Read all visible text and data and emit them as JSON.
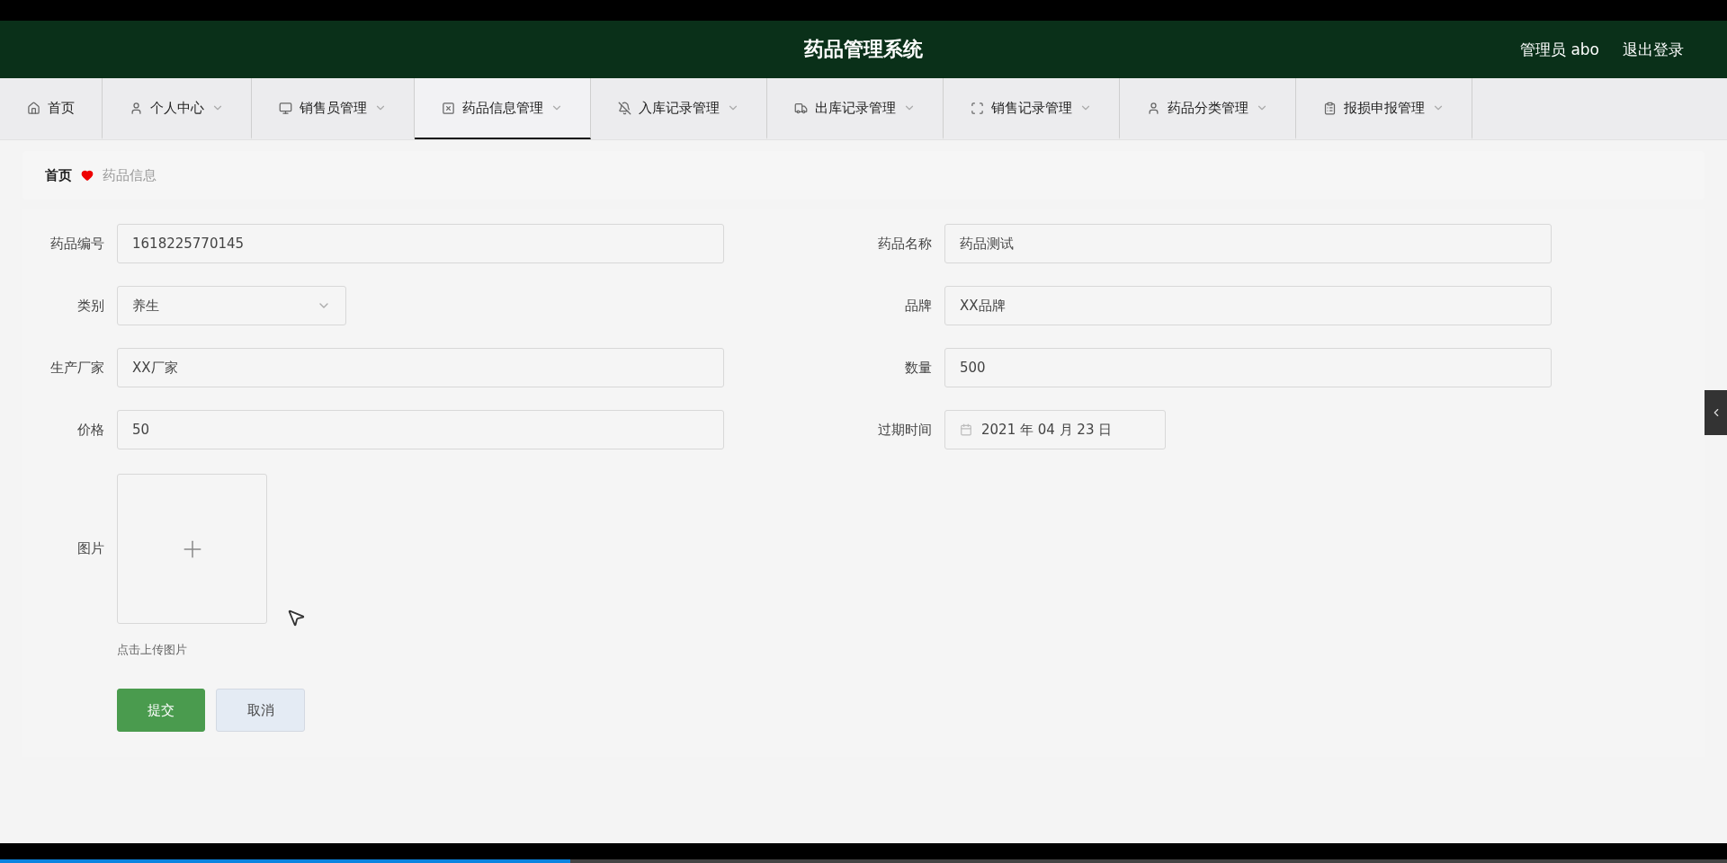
{
  "header": {
    "title": "药品管理系统",
    "user": "管理员 abo",
    "logout": "退出登录"
  },
  "nav": [
    {
      "label": "首页",
      "dropdown": false,
      "selected": false
    },
    {
      "label": "个人中心",
      "dropdown": true,
      "selected": false
    },
    {
      "label": "销售员管理",
      "dropdown": true,
      "selected": false
    },
    {
      "label": "药品信息管理",
      "dropdown": true,
      "selected": true
    },
    {
      "label": "入库记录管理",
      "dropdown": true,
      "selected": false
    },
    {
      "label": "出库记录管理",
      "dropdown": true,
      "selected": false
    },
    {
      "label": "销售记录管理",
      "dropdown": true,
      "selected": false
    },
    {
      "label": "药品分类管理",
      "dropdown": true,
      "selected": false
    },
    {
      "label": "报损申报管理",
      "dropdown": true,
      "selected": false
    }
  ],
  "breadcrumb": [
    "首页",
    "药品信息"
  ],
  "form": {
    "left": [
      {
        "label": "药品编号",
        "kind": "text",
        "value": "1618225770145"
      },
      {
        "label": "类别",
        "kind": "select",
        "value": "养生"
      },
      {
        "label": "生产厂家",
        "kind": "text",
        "value": "XX厂家"
      },
      {
        "label": "价格",
        "kind": "text",
        "value": "50"
      }
    ],
    "right": [
      {
        "label": "药品名称",
        "kind": "text",
        "value": "药品测试"
      },
      {
        "label": "品牌",
        "kind": "text",
        "value": "XX品牌"
      },
      {
        "label": "数量",
        "kind": "text",
        "value": "500"
      },
      {
        "label": "过期时间",
        "kind": "date",
        "value": "2021 年 04 月 23 日"
      }
    ],
    "image": {
      "label": "图片",
      "hint": "点击上传图片"
    },
    "buttons": [
      {
        "label": "提交",
        "kind": "primary"
      },
      {
        "label": "取消",
        "kind": "secondary"
      }
    ]
  },
  "player": {
    "level": 0.33
  }
}
